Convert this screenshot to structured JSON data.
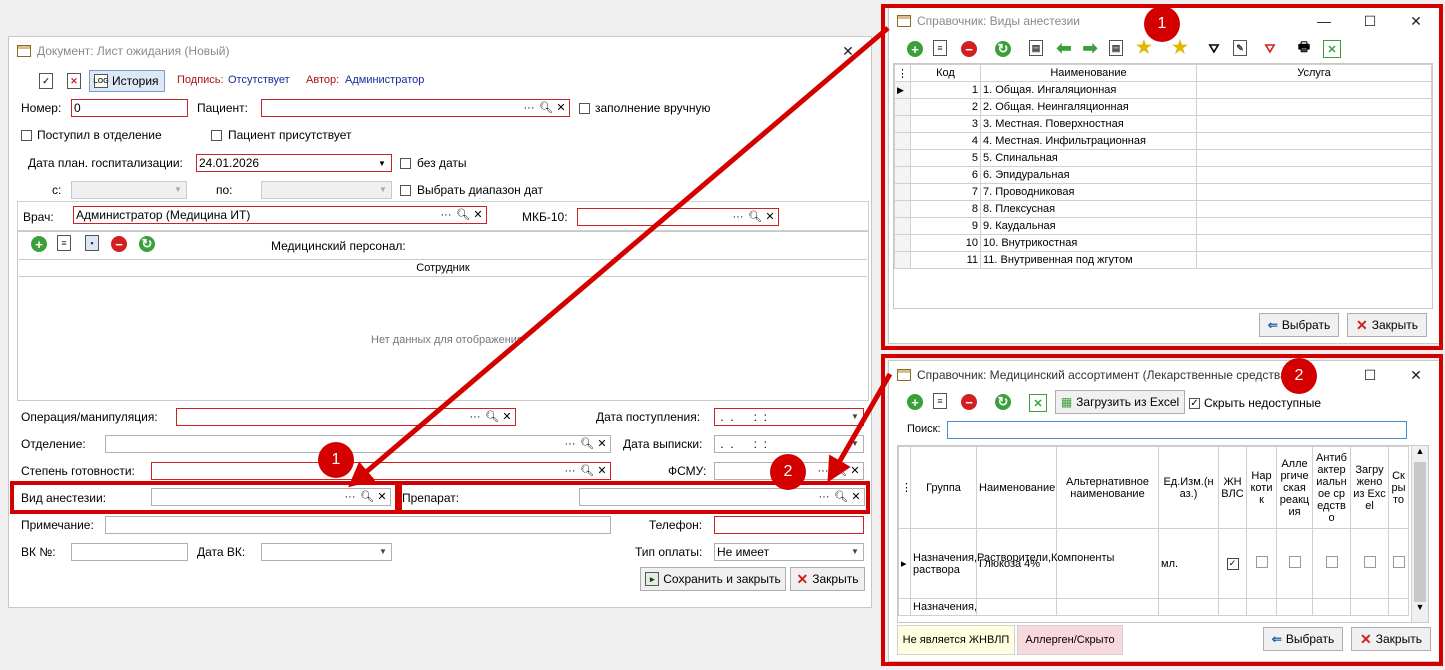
{
  "main_window": {
    "title": "Документ: Лист ожидания (Новый)",
    "history_label": "История",
    "signature_label": "Подпись:",
    "signature_value": "Отсутствует",
    "author_label": "Автор:",
    "author_value": "Администратор"
  },
  "form": {
    "number_label": "Номер:",
    "number_value": "0",
    "patient_label": "Пациент:",
    "manual_fill_label": "заполнение вручную",
    "admitted_label": "Поступил в отделение",
    "patient_present_label": "Пациент присутствует",
    "plan_date_label": "Дата план. госпитализации:",
    "plan_date_value": "24.01.2026",
    "no_date_label": "без даты",
    "from_label": "с:",
    "to_label": "по:",
    "date_range_label": "Выбрать диапазон дат",
    "doctor_label": "Врач:",
    "doctor_value": "Администратор (Медицина ИТ)",
    "mkb_label": "МКБ-10:",
    "medical_staff_label": "Медицинский персонал:",
    "staff_column": "Сотрудник",
    "no_data": "Нет данных для отображения",
    "operation_label": "Операция/манипуляция:",
    "arrival_date_label": "Дата поступления:",
    "arrival_date_value": " .  .      :  :",
    "department_label": "Отделение:",
    "discharge_date_label": "Дата выписки:",
    "discharge_date_value": " .  .      :  :",
    "readiness_label": "Степень готовности:",
    "fsmu_label": "ФСМУ:",
    "anesthesia_label": "Вид анестезии:",
    "drug_label": "Препарат:",
    "note_label": "Примечание:",
    "phone_label": "Телефон:",
    "vk_number_label": "ВК №:",
    "vk_date_label": "Дата ВК:",
    "payment_type_label": "Тип оплаты:",
    "payment_type_value": "Не имеет",
    "save_close_label": "Сохранить и закрыть",
    "close_label": "Закрыть"
  },
  "anesthesia_dialog": {
    "title": "Справочник: Виды анестезии",
    "columns": [
      "Код",
      "Наименование",
      "Услуга"
    ],
    "rows": [
      {
        "code": "1",
        "name": "1. Общая. Ингаляционная"
      },
      {
        "code": "2",
        "name": "2. Общая. Неингаляционная"
      },
      {
        "code": "3",
        "name": "3. Местная. Поверхностная"
      },
      {
        "code": "4",
        "name": "4. Местная. Инфильтрационная"
      },
      {
        "code": "5",
        "name": "5. Спинальная"
      },
      {
        "code": "6",
        "name": "6. Эпидуральная"
      },
      {
        "code": "7",
        "name": "7. Проводниковая"
      },
      {
        "code": "8",
        "name": "8. Плексусная"
      },
      {
        "code": "9",
        "name": "9. Каудальная"
      },
      {
        "code": "10",
        "name": "10. Внутрикостная"
      },
      {
        "code": "11",
        "name": "11. Внутривенная под жгутом"
      }
    ],
    "select_label": "Выбрать",
    "close_label": "Закрыть"
  },
  "drug_dialog": {
    "title": "Справочник: Медицинский ассортимент (Лекарственные средства",
    "load_excel_label": "Загрузить из Excel",
    "hide_unavailable_label": "Скрыть недоступные",
    "search_label": "Поиск:",
    "columns": [
      "Группа",
      "Наименование",
      "Альтернативное наименование",
      "Ед.Изм.(наз.)",
      "ЖНВЛС",
      "Наркотик",
      "Аллергическая реакция",
      "Антибактериальное средство",
      "Загружено из Excel",
      "Скрыто"
    ],
    "row1": {
      "group": "Назначения,Растворители,Компоненты раствора",
      "name": "Глюкоза 4%",
      "unit": "мл."
    },
    "row2_group": "Назначения,Растворит",
    "legend_1": "Не является ЖНВЛП",
    "legend_2": "Аллерген/Скрыто",
    "select_label": "Выбрать",
    "close_label": "Закрыть"
  },
  "badges": {
    "one": "1",
    "two": "2"
  },
  "colors": {
    "highlight": "#d40000",
    "legend_yellow": "#ffffe0",
    "legend_pink": "#f8d8dc"
  }
}
